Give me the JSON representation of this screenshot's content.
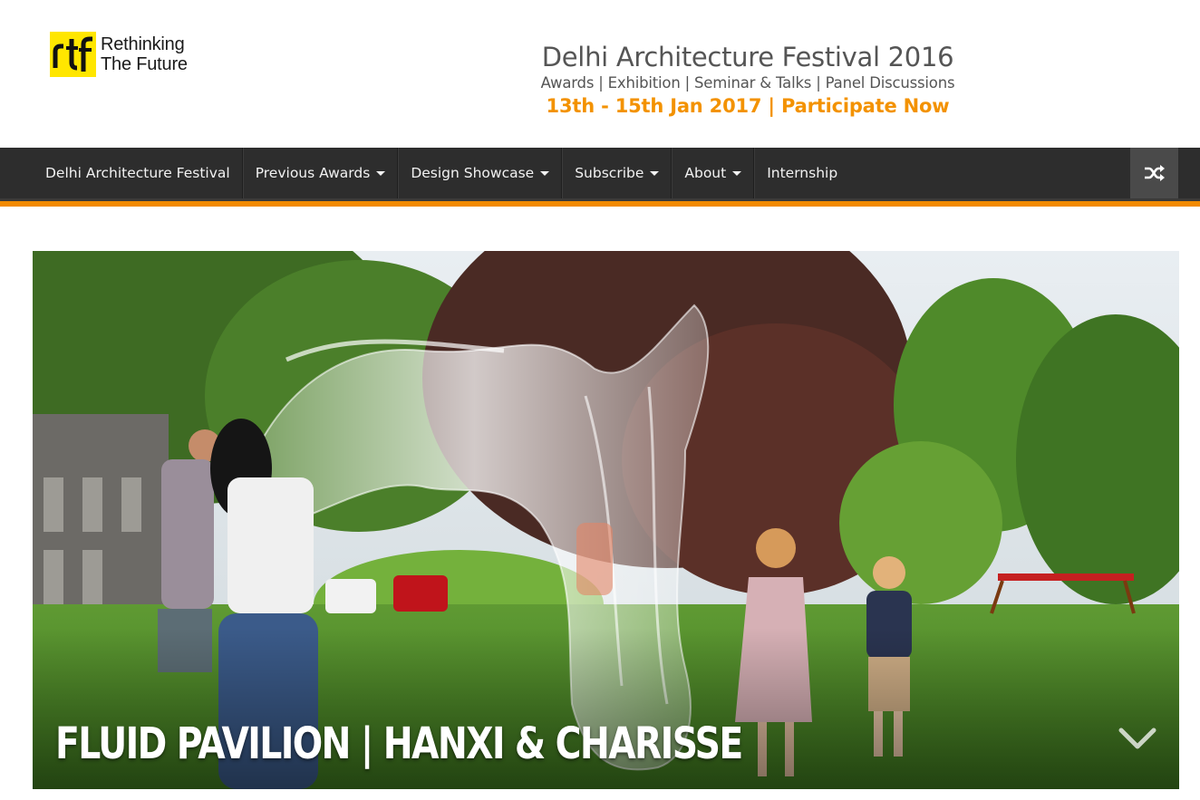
{
  "site": {
    "logo_line1": "Rethinking",
    "logo_line2": "The Future",
    "logo_mark_text": "rtf"
  },
  "banner": {
    "title": "Delhi Architecture Festival 2016",
    "subtitle": "Awards | Exhibition | Seminar & Talks | Panel Discussions",
    "date_cta": "13th - 15th Jan 2017 | Participate Now"
  },
  "nav": {
    "items": [
      {
        "label": "Delhi Architecture Festival",
        "dropdown": false
      },
      {
        "label": "Previous Awards",
        "dropdown": true
      },
      {
        "label": "Design Showcase",
        "dropdown": true
      },
      {
        "label": "Subscribe",
        "dropdown": true
      },
      {
        "label": "About",
        "dropdown": true
      },
      {
        "label": "Internship",
        "dropdown": false
      }
    ],
    "random_icon": "shuffle-icon"
  },
  "featured": {
    "title": "FLUID PAVILION | HANXI & CHARISSE",
    "next_icon": "chevron-down-icon"
  },
  "colors": {
    "accent": "#f28a00",
    "nav_bg": "#2d2d2d",
    "banner_orange": "#f39200",
    "logo_yellow": "#ffe600"
  }
}
